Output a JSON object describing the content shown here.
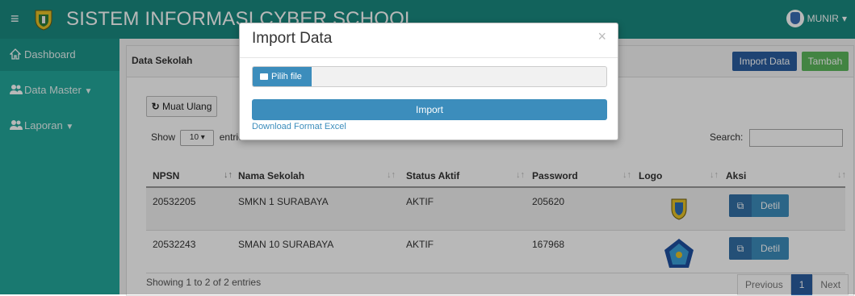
{
  "navbar": {
    "title": "SISTEM INFORMASI CYBER SCHOOL",
    "menu_icon": "hamburger-icon",
    "user_name": "MUNIR",
    "user_caret": "▾"
  },
  "sidebar": {
    "items": [
      {
        "label": "Dashboard",
        "icon": "home-icon"
      },
      {
        "label": "Data Master",
        "icon": "users-icon",
        "caret": "▼"
      },
      {
        "label": "Laporan",
        "icon": "users-icon",
        "caret": "▼"
      }
    ]
  },
  "panel": {
    "title": "Data Sekolah",
    "import_label": "Import Data",
    "add_label": "Tambah",
    "reload_label": "Muat Ulang",
    "show_label": "Show",
    "entries_label": "entries",
    "page_size": "10",
    "search_label": "Search:"
  },
  "table": {
    "columns": [
      "NPSN",
      "Nama Sekolah",
      "Status Aktif",
      "Password",
      "Logo",
      "Aksi"
    ],
    "rows": [
      {
        "npsn": "20532205",
        "nama": "SMKN 1 SURABAYA",
        "status": "AKTIF",
        "password": "205620",
        "action": "Detil"
      },
      {
        "npsn": "20532243",
        "nama": "SMAN 10 SURABAYA",
        "status": "AKTIF",
        "password": "167968",
        "action": "Detil"
      }
    ],
    "info": "Showing 1 to 2 of 2 entries",
    "pagination": {
      "previous": "Previous",
      "current": "1",
      "next": "Next"
    }
  },
  "modal": {
    "title": "Import Data",
    "close": "×",
    "file_button": "Pilih file",
    "submit_label": "Import",
    "download_link": "Download Format Excel"
  },
  "colors": {
    "navbar": "#1a8a80",
    "sidebar": "#23a89c",
    "primary": "#3c8dbc",
    "dark_blue": "#2a5ea0",
    "green": "#5cb85c"
  }
}
